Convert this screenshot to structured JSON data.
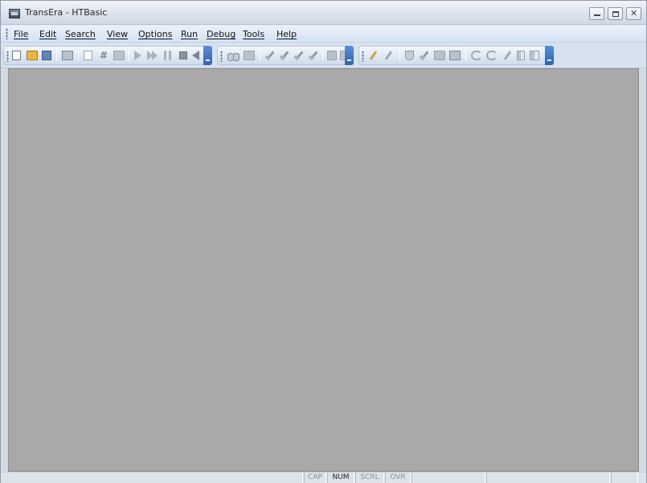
{
  "window": {
    "title": "TransEra - HTBasic",
    "controls": {
      "minimize": "minimize",
      "maximize": "maximize",
      "close": "✕"
    }
  },
  "menu": {
    "items": [
      "File",
      "Edit",
      "Search",
      "View",
      "Options",
      "Run",
      "Debug",
      "Tools",
      "Help"
    ]
  },
  "toolbars": {
    "main": [
      "new",
      "open",
      "save",
      "print",
      "edit",
      "line-numbers",
      "list",
      "run",
      "continue",
      "pause",
      "stop",
      "step-back"
    ],
    "search": [
      "find",
      "replace",
      "tool-a",
      "tool-b",
      "tool-c",
      "tool-d",
      "bookmark-a",
      "bookmark-b"
    ],
    "debug": [
      "brush",
      "brush-color",
      "flask",
      "scissors",
      "copy",
      "paste",
      "undo",
      "redo",
      "pen",
      "tab",
      "tab-right"
    ]
  },
  "status": {
    "cap": "CAP",
    "num": "NUM",
    "scrl": "SCRL",
    "ovr": "OVR",
    "active": [
      "NUM"
    ]
  },
  "colors": {
    "client_background": "#a9a9a9",
    "menubar": "#d6e2f2",
    "toolbar_end": "#2e62b4"
  }
}
